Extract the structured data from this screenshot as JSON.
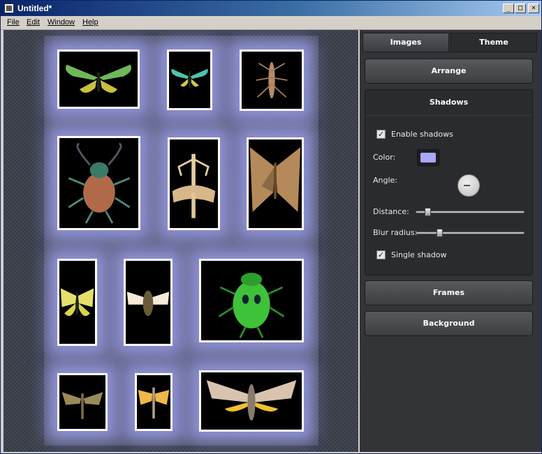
{
  "window": {
    "title": "Untitled*",
    "minimize": "_",
    "maximize": "□",
    "close": "×"
  },
  "menu": {
    "file": "File",
    "edit": "Edit",
    "window": "Window",
    "help": "Help"
  },
  "tabs": {
    "images": "Images",
    "theme": "Theme",
    "active": "Theme"
  },
  "sections": {
    "arrange": "Arrange",
    "frames": "Frames",
    "background": "Background"
  },
  "shadows": {
    "title": "Shadows",
    "enable_label": "Enable shadows",
    "enable_checked": true,
    "color_label": "Color:",
    "color_value": "#a8a8ff",
    "angle_label": "Angle:",
    "distance_label": "Distance:",
    "distance_value": 0.08,
    "blur_label": "Blur radius:",
    "blur_value": 0.2,
    "single_label": "Single shadow",
    "single_checked": true
  },
  "check_glyph": "✓",
  "photos": [
    {
      "name": "photo-butterfly-green-1",
      "subject": "butterfly"
    },
    {
      "name": "photo-butterfly-green-2",
      "subject": "butterfly"
    },
    {
      "name": "photo-grasshopper",
      "subject": "stick insect"
    },
    {
      "name": "photo-beetle-copper",
      "subject": "beetle"
    },
    {
      "name": "photo-mantis",
      "subject": "mantis"
    },
    {
      "name": "photo-moth-brown",
      "subject": "moth"
    },
    {
      "name": "photo-butterfly-yellow",
      "subject": "butterfly"
    },
    {
      "name": "photo-cicada",
      "subject": "cicada"
    },
    {
      "name": "photo-beetle-green",
      "subject": "beetle"
    },
    {
      "name": "photo-hawkmoth-small",
      "subject": "hawkmoth"
    },
    {
      "name": "photo-locust-yellow",
      "subject": "locust"
    },
    {
      "name": "photo-moth-large",
      "subject": "moth"
    }
  ]
}
